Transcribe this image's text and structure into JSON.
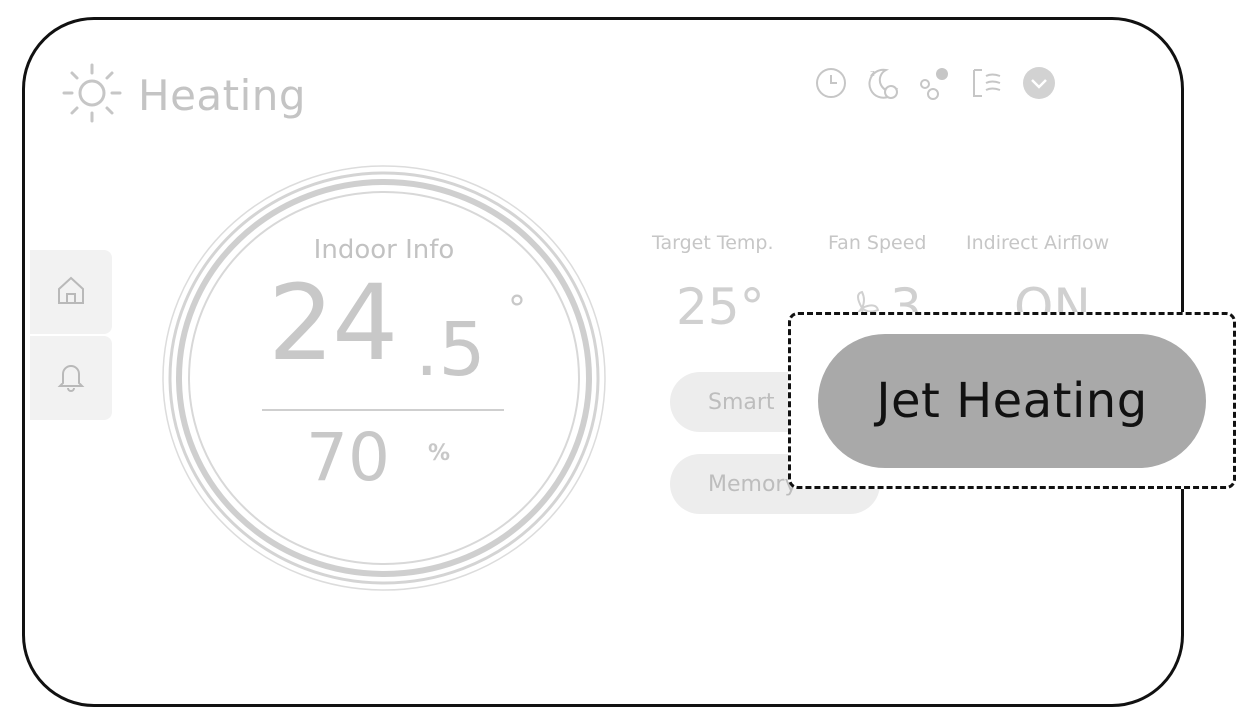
{
  "header": {
    "mode_icon": "sun-icon",
    "title": "Heating"
  },
  "status_icons": [
    "clock-icon",
    "sleep-moon-icon",
    "air-purify-icon",
    "airflow-icon",
    "chevron-down-icon"
  ],
  "sidebar": {
    "items": [
      {
        "icon": "home-icon"
      },
      {
        "icon": "bell-icon"
      }
    ]
  },
  "indoor": {
    "label": "Indoor Info",
    "temp_whole": "24",
    "temp_fraction": ".5",
    "temp_unit": "°",
    "humidity": "70",
    "humidity_unit": "%"
  },
  "stats": [
    {
      "label": "Target Temp.",
      "value": "25°"
    },
    {
      "label": "Fan Speed",
      "value": "3",
      "icon": "fan-icon"
    },
    {
      "label": "Indirect Airflow",
      "value": "ON"
    }
  ],
  "buttons": {
    "smart": "Smart",
    "memory": "Memory"
  },
  "jet": {
    "label": "Jet Heating"
  },
  "colors": {
    "faded_text": "#c8c8c8",
    "jet_button_bg": "#a9a9a9",
    "border": "#111111"
  }
}
